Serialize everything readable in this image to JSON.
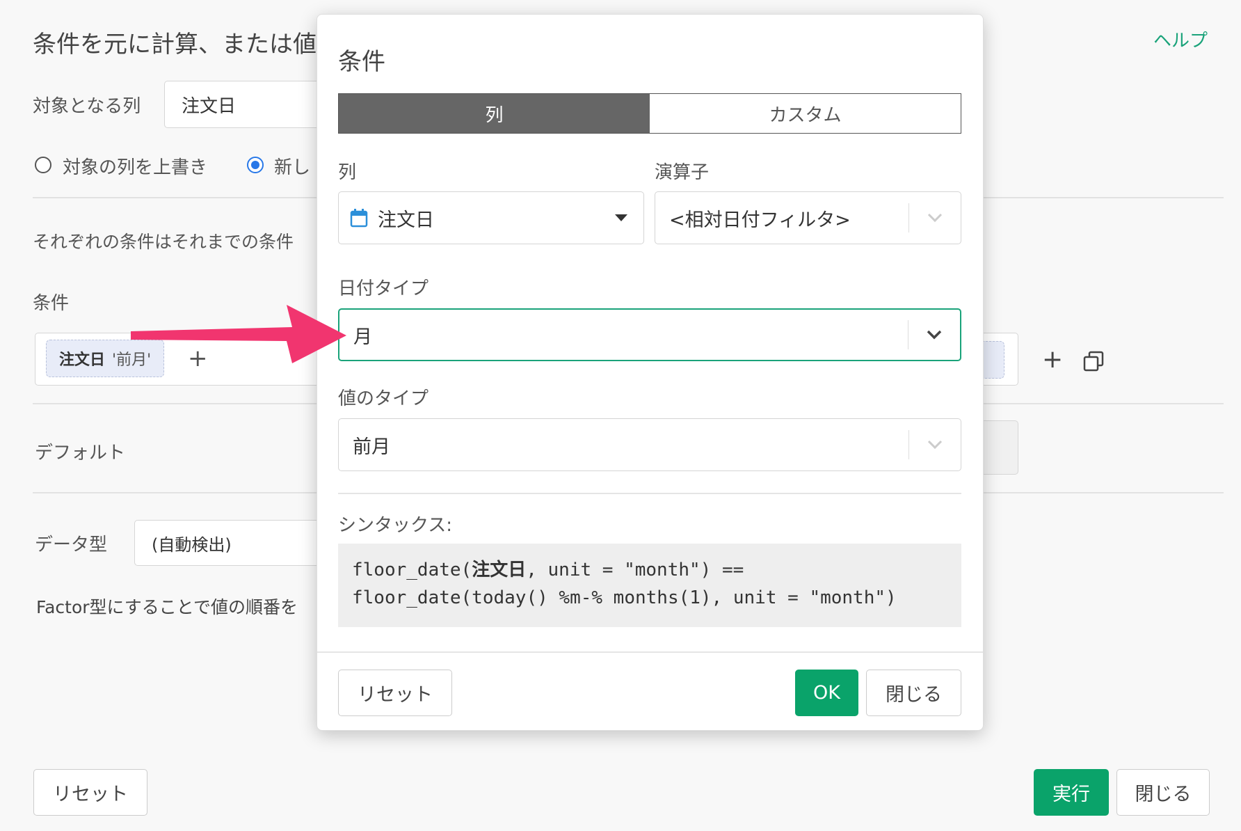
{
  "background": {
    "title": "条件を元に計算、または値",
    "help_link": "ヘルプ",
    "target_column_label": "対象となる列",
    "target_column_value": "注文日",
    "radio_overwrite_label": "対象の列を上書き",
    "radio_new_label": "新し",
    "description": "それぞれの条件はそれまでの条件",
    "conditions_label": "条件",
    "condition_chip": {
      "column": "注文日",
      "value": "'前月'"
    },
    "add_symbol": "+",
    "default_label": "デフォルト",
    "datatype_label": "データ型",
    "datatype_value": "(自動検出)",
    "factor_note": "Factor型にすることで値の順番を",
    "reset_button": "リセット",
    "run_button": "実行",
    "close_button": "閉じる"
  },
  "modal": {
    "title": "条件",
    "tabs": [
      {
        "label": "列",
        "active": true
      },
      {
        "label": "カスタム",
        "active": false
      }
    ],
    "column_label": "列",
    "column_value": "注文日",
    "operator_label": "演算子",
    "operator_value": "<相対日付フィルタ>",
    "date_type_label": "日付タイプ",
    "date_type_value": "月",
    "value_type_label": "値のタイプ",
    "value_type_value": "前月",
    "syntax_label": "シンタックス:",
    "syntax_line1_pre": "floor_date(",
    "syntax_line1_col": "注文日",
    "syntax_line1_post": ", unit = \"month\") ==",
    "syntax_line2": "floor_date(today() %m-% months(1), unit = \"month\")",
    "reset_button": "リセット",
    "ok_button": "OK",
    "close_button": "閉じる"
  },
  "colors": {
    "accent_green": "#0aa36a",
    "focus_green": "#1aa37a",
    "arrow_pink": "#f1356f",
    "calendar_blue": "#2b8fd9"
  }
}
